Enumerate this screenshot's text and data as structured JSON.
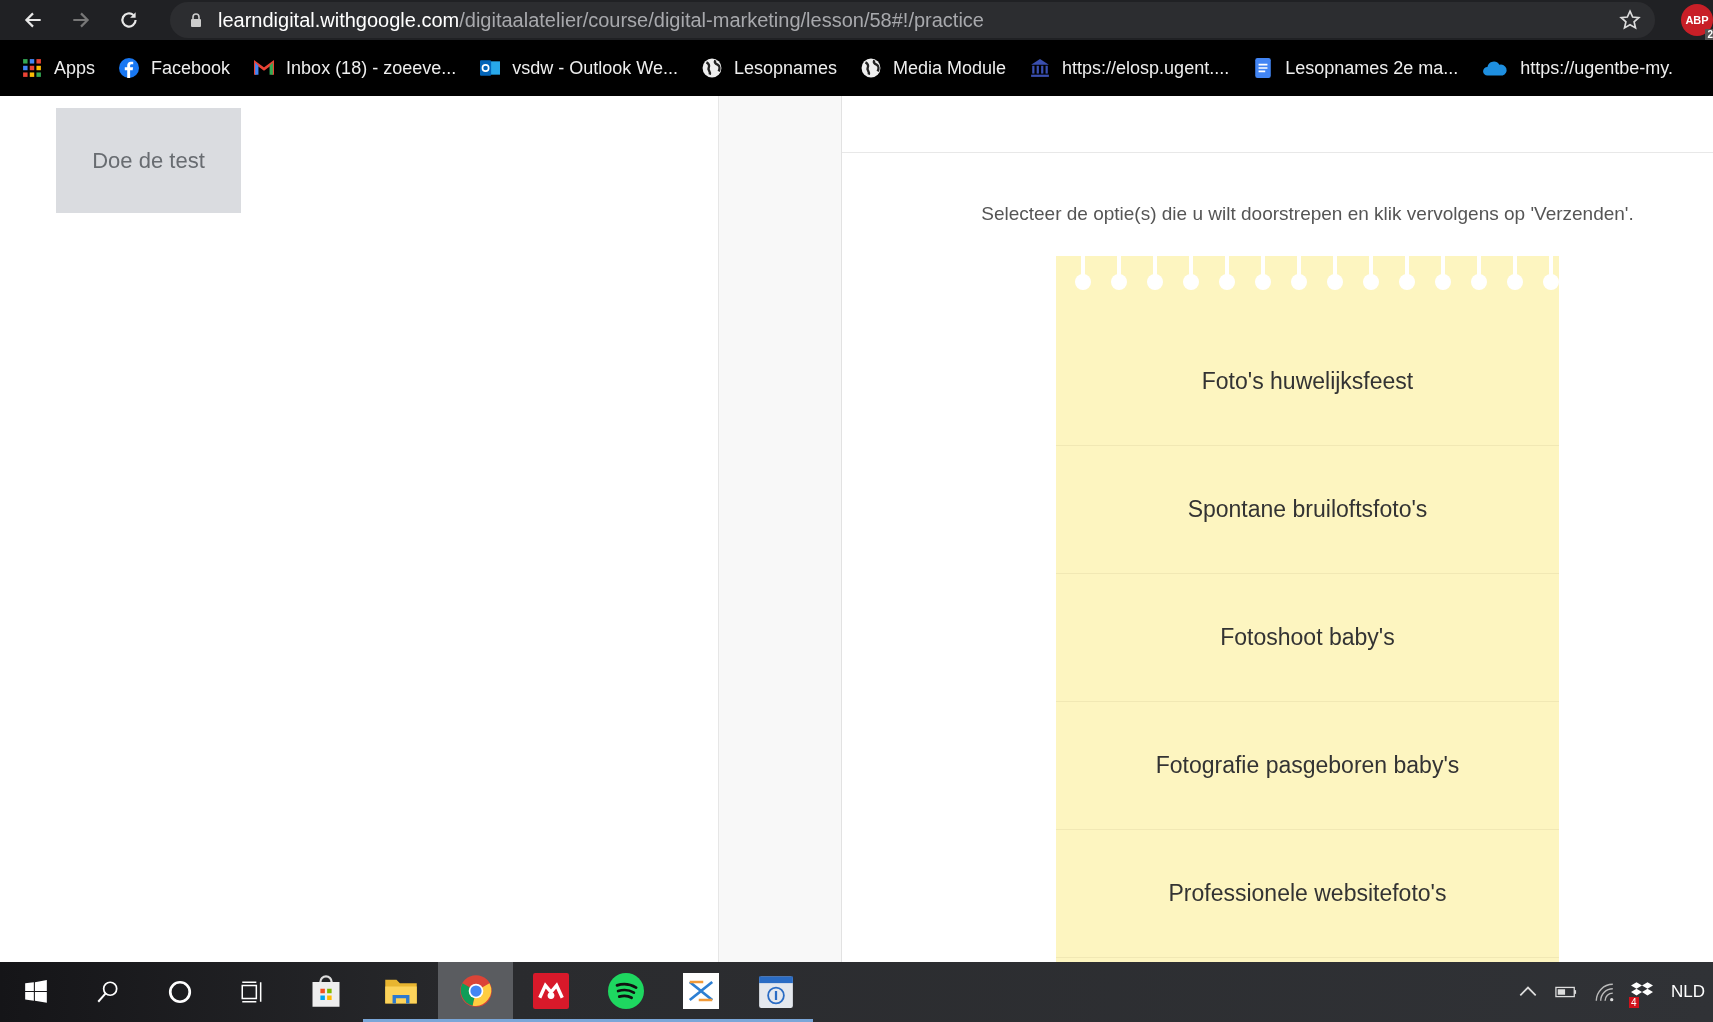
{
  "browser": {
    "url_host": "learndigital.withgoogle.com",
    "url_path": "/digitaalatelier/course/digital-marketing/lesson/58#!/practice",
    "extension": {
      "label": "ABP",
      "badge": "2"
    },
    "bookmarks": [
      {
        "kind": "apps",
        "label": "Apps"
      },
      {
        "kind": "facebook",
        "label": "Facebook"
      },
      {
        "kind": "gmail",
        "label": "Inbox (18) - zoeeve..."
      },
      {
        "kind": "outlook",
        "label": "vsdw - Outlook We..."
      },
      {
        "kind": "globe",
        "label": "Lesopnames"
      },
      {
        "kind": "globe",
        "label": "Media Module"
      },
      {
        "kind": "bank",
        "label": "https://elosp.ugent...."
      },
      {
        "kind": "docs",
        "label": "Lesopnames 2e ma..."
      },
      {
        "kind": "cloud",
        "label": "https://ugentbe-my."
      }
    ]
  },
  "test_button": {
    "label": "Doe de test",
    "disabled": true
  },
  "instruction": "Selecteer de optie(s) die u wilt doorstrepen en klik vervolgens op 'Verzenden'.",
  "options": [
    {
      "label": "Foto's huwelijksfeest",
      "selected": false
    },
    {
      "label": "Spontane bruiloftsfoto's",
      "selected": false
    },
    {
      "label": "Fotoshoot baby's",
      "selected": false
    },
    {
      "label": "Fotografie pasgeboren baby's",
      "selected": false
    },
    {
      "label": "Professionele websitefoto's",
      "selected": false
    }
  ],
  "taskbar": {
    "apps": [
      {
        "kind": "store",
        "running": false,
        "active": false
      },
      {
        "kind": "explorer",
        "running": true,
        "active": false
      },
      {
        "kind": "chrome",
        "running": true,
        "active": true
      },
      {
        "kind": "mendeley",
        "running": true,
        "active": false
      },
      {
        "kind": "spotify",
        "running": true,
        "active": false
      },
      {
        "kind": "zotero",
        "running": true,
        "active": false
      },
      {
        "kind": "calendar",
        "running": true,
        "active": false
      }
    ],
    "tray_badge": "4",
    "language": "NLD"
  }
}
